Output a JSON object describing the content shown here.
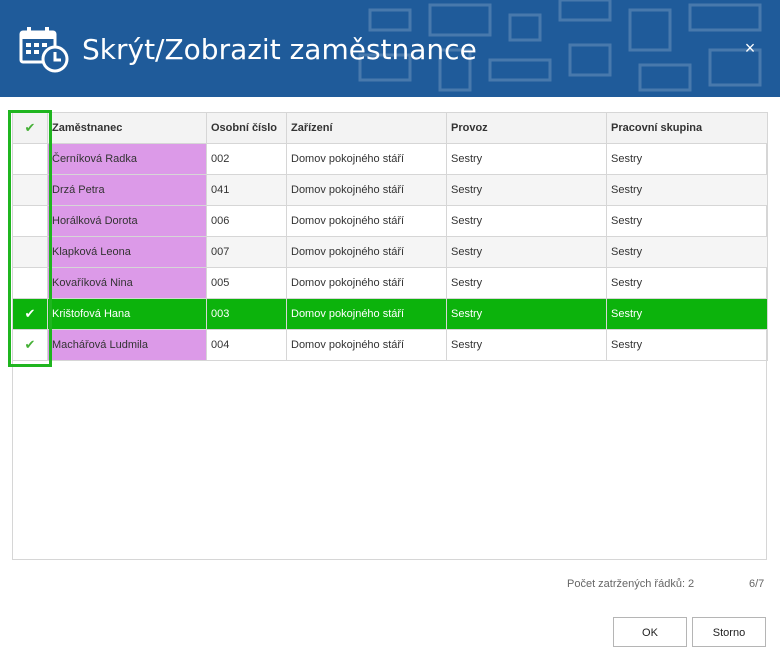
{
  "dialog": {
    "title": "Skrýt/Zobrazit zaměstnance",
    "close_glyph": "×",
    "icon": "calendar-clock-icon",
    "colors": {
      "header": "#1f5b9a",
      "selected_row": "#0cb30c",
      "name_cell": "#dc9ae8",
      "check": "#45b036"
    }
  },
  "grid": {
    "columns": [
      "✔",
      "Zaměstnanec",
      "Osobní číslo",
      "Zařízení",
      "Provoz",
      "Pracovní skupina"
    ],
    "rows": [
      {
        "checked": "",
        "name": "Černíková Radka",
        "number": "002",
        "facility": "Domov pokojného stáří",
        "operation": "Sestry",
        "group": "Sestry"
      },
      {
        "checked": "",
        "name": "Drzá Petra",
        "number": "041",
        "facility": "Domov pokojného stáří",
        "operation": "Sestry",
        "group": "Sestry"
      },
      {
        "checked": "",
        "name": "Horálková Dorota",
        "number": "006",
        "facility": "Domov pokojného stáří",
        "operation": "Sestry",
        "group": "Sestry"
      },
      {
        "checked": "",
        "name": "Klapková Leona",
        "number": "007",
        "facility": "Domov pokojného stáří",
        "operation": "Sestry",
        "group": "Sestry"
      },
      {
        "checked": "",
        "name": "Kovaříková Nina",
        "number": "005",
        "facility": "Domov pokojného stáří",
        "operation": "Sestry",
        "group": "Sestry"
      },
      {
        "checked": "✔",
        "name": "Krištofová Hana",
        "number": "003",
        "facility": "Domov pokojného stáří",
        "operation": "Sestry",
        "group": "Sestry"
      },
      {
        "checked": "✔",
        "name": "Machářová Ludmila",
        "number": "004",
        "facility": "Domov pokojného stáří",
        "operation": "Sestry",
        "group": "Sestry"
      }
    ]
  },
  "footer": {
    "checked_count": "Počet zatržených řádků: 2",
    "page_count": "6/7",
    "ok_label": "OK",
    "cancel_label": "Storno"
  }
}
